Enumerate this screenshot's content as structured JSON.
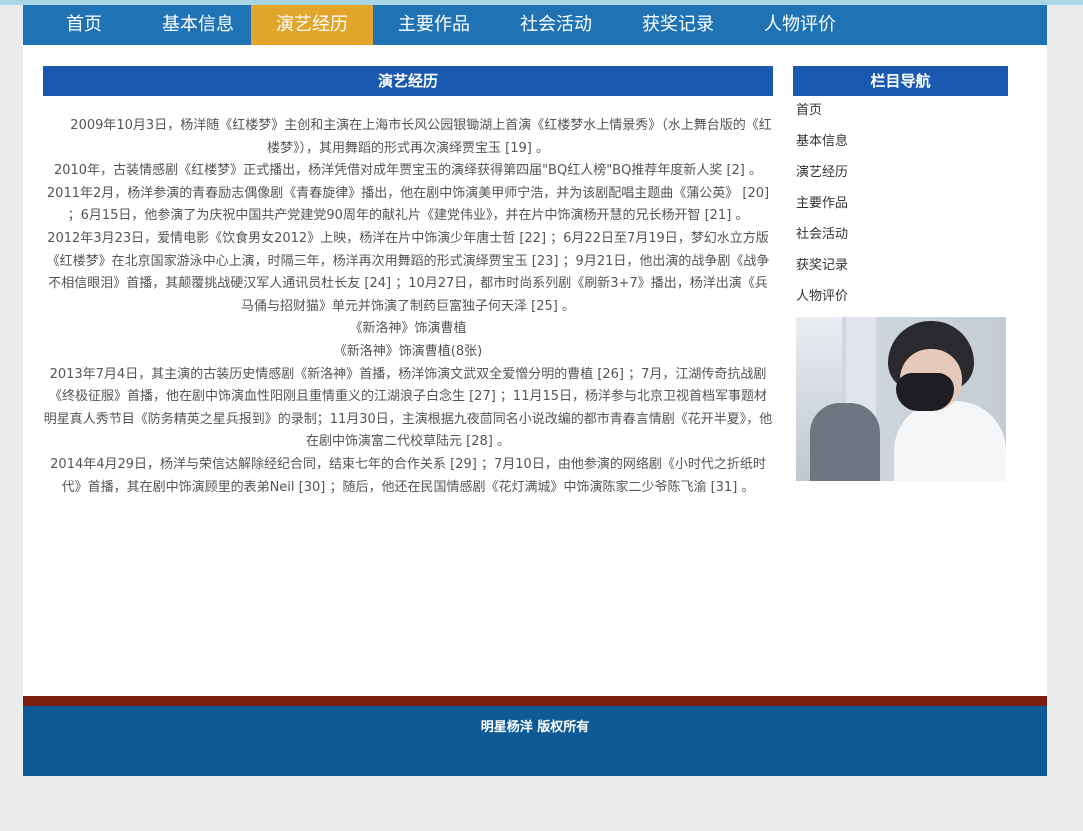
{
  "nav": {
    "items": [
      "首页",
      "基本信息",
      "演艺经历",
      "主要作品",
      "社会活动",
      "获奖记录",
      "人物评价"
    ],
    "active": "演艺经历"
  },
  "main": {
    "title": "演艺经历",
    "paragraphs": [
      "2009年10月3日，杨洋随《红楼梦》主创和主演在上海市长风公园银锄湖上首演《红楼梦水上情景秀》（水上舞台版的《红楼梦》），其用舞蹈的形式再次演绎贾宝玉 [19] 。",
      "2010年，古装情感剧《红楼梦》正式播出，杨洋凭借对成年贾宝玉的演绎获得第四届\"BQ红人榜\"BQ推荐年度新人奖 [2] 。",
      "2011年2月，杨洋参演的青春励志偶像剧《青春旋律》播出，他在剧中饰演美甲师宁浩，并为该剧配唱主题曲《蒲公英》 [20] ；6月15日，他参演了为庆祝中国共产党建党90周年的献礼片《建党伟业》，并在片中饰演杨开慧的兄长杨开智 [21] 。",
      "2012年3月23日，爱情电影《饮食男女2012》上映，杨洋在片中饰演少年唐士哲 [22] ；6月22日至7月19日，梦幻水立方版《红楼梦》在北京国家游泳中心上演，时隔三年，杨洋再次用舞蹈的形式演绎贾宝玉 [23] ；9月21日，他出演的战争剧《战争不相信眼泪》首播，其颠覆挑战硬汉军人通讯员杜长友 [24] ；10月27日，都市时尚系列剧《刷新3+7》播出，杨洋出演《兵马俑与招财猫》单元并饰演了制药巨富独子何天泽 [25] 。",
      "《新洛神》饰演曹植",
      "《新洛神》饰演曹植(8张)",
      "2013年7月4日，其主演的古装历史情感剧《新洛神》首播，杨洋饰演文武双全爱憎分明的曹植 [26] ；7月，江湖传奇抗战剧《终极征服》首播，他在剧中饰演血性阳刚且重情重义的江湖浪子白念生 [27] ；11月15日，杨洋参与北京卫视首档军事题材明星真人秀节目《防务精英之星兵报到》的录制；11月30日，主演根据九夜茴同名小说改编的都市青春言情剧《花开半夏》，他在剧中饰演富二代校草陆元 [28] 。",
      "2014年4月29日，杨洋与荣信达解除经纪合同，结束七年的合作关系 [29] ；7月10日，由他参演的网络剧《小时代之折纸时代》首播，其在剧中饰演顾里的表弟Neil [30] ；随后，他还在民国情感剧《花灯满城》中饰演陈家二少爷陈飞渝 [31] 。"
    ]
  },
  "sidebar": {
    "title": "栏目导航",
    "items": [
      "首页",
      "基本信息",
      "演艺经历",
      "主要作品",
      "社会活动",
      "获奖记录",
      "人物评价"
    ],
    "photo_icon": "portrait-photo"
  },
  "footer": {
    "copyright": "明星杨洋 版权所有"
  },
  "colors": {
    "nav_bg": "#1f73b5",
    "nav_active": "#e2a52c",
    "heading_bg": "#1a59b0",
    "footer_bar": "#7a1c0e",
    "footer_bg": "#0d5a96"
  }
}
